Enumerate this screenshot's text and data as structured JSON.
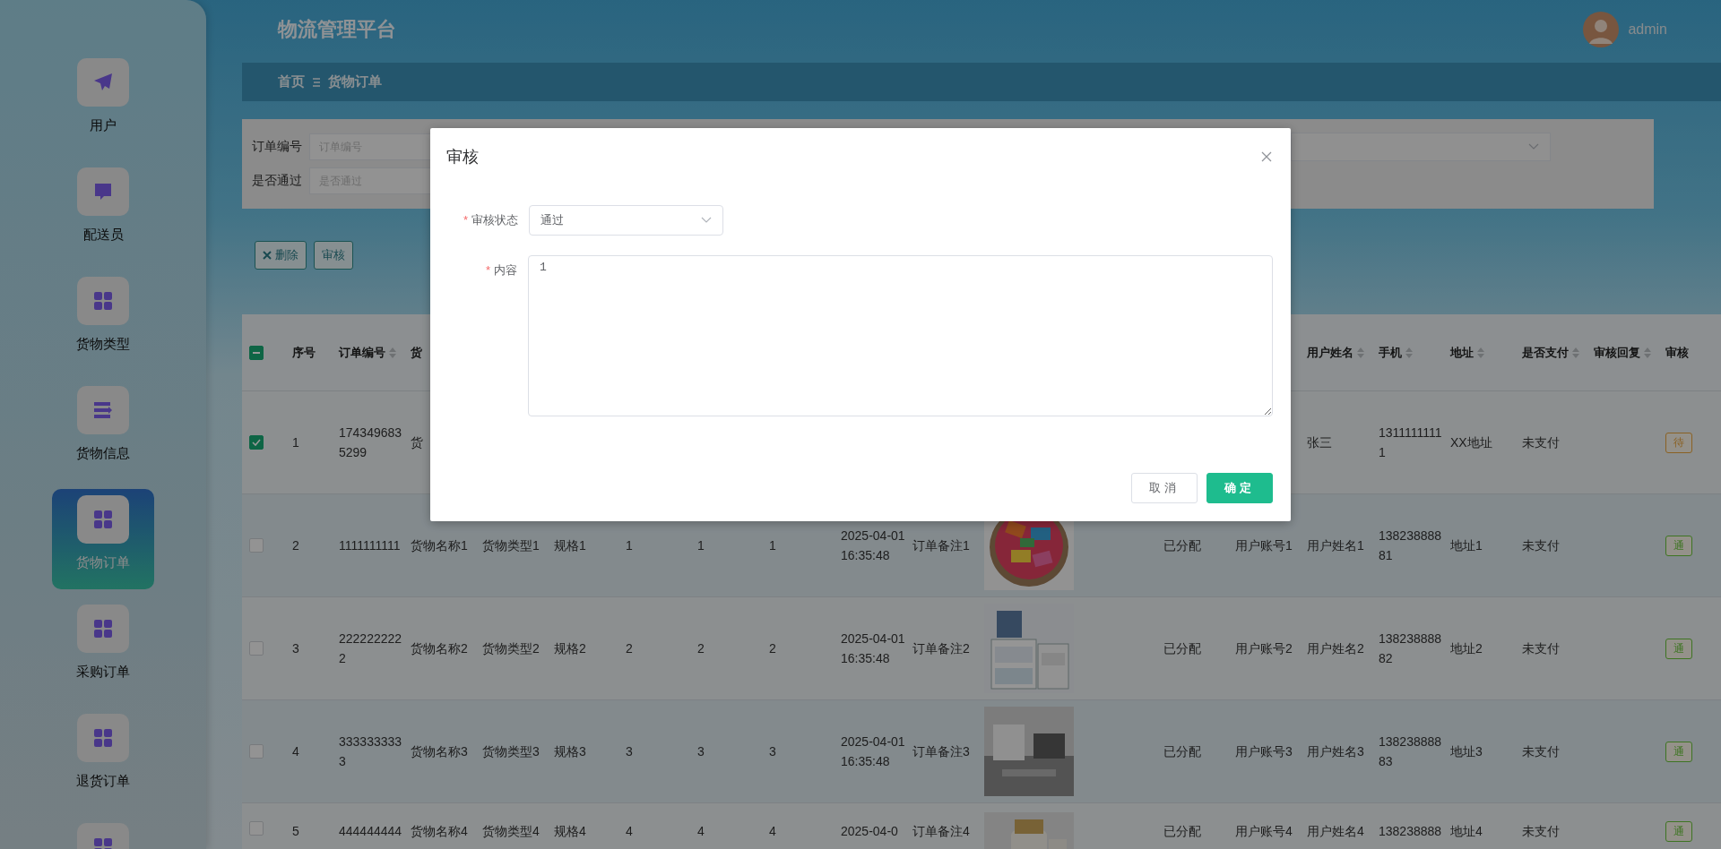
{
  "sidebar": {
    "items": [
      {
        "label": "用户",
        "selected": false
      },
      {
        "label": "配送员",
        "selected": false
      },
      {
        "label": "货物类型",
        "selected": false
      },
      {
        "label": "货物信息",
        "selected": false
      },
      {
        "label": "货物订单",
        "selected": true
      },
      {
        "label": "采购订单",
        "selected": false
      },
      {
        "label": "退货订单",
        "selected": false
      },
      {
        "selected": false
      }
    ]
  },
  "header": {
    "title": "物流管理平台",
    "user": "admin"
  },
  "breadcrumb": [
    "首页",
    "货物订单"
  ],
  "search": {
    "fields": [
      {
        "label": "订单编号",
        "placeholder": "订单编号"
      },
      {
        "label": "是否通过",
        "placeholder": "是否通过"
      }
    ]
  },
  "actions": [
    {
      "label": "删除"
    },
    {
      "label": "审核"
    }
  ],
  "table": {
    "header_checkbox": {
      "indeterminate": true
    },
    "columns": [
      {
        "label": "序号",
        "sortable": false
      },
      {
        "label": "订单编号",
        "sortable": true
      },
      {
        "label": "货",
        "sortable": false
      },
      null,
      null,
      null,
      null,
      null,
      null,
      null,
      null,
      null,
      null,
      null,
      {
        "label": "用户姓名",
        "sortable": true
      },
      {
        "label": "手机",
        "sortable": true
      },
      {
        "label": "地址",
        "sortable": true
      },
      {
        "label": "是否支付",
        "sortable": true
      },
      {
        "label": "审核回复",
        "sortable": true
      },
      {
        "label": "审核",
        "sortable": false
      }
    ],
    "rows": [
      {
        "kind": "full",
        "checked": true,
        "cells": [
          "1",
          "1743496835299",
          "货",
          null,
          null,
          null,
          null,
          null,
          null,
          null,
          null,
          null,
          null,
          null,
          "张三",
          "13111111111",
          "XX地址",
          "未支付",
          null
        ],
        "tag": {
          "text": "待",
          "kind": "pending"
        }
      },
      {
        "kind": "full",
        "checked": false,
        "cells": [
          "2",
          "1111111111",
          "货物名称1",
          "货物类型1",
          "规格1",
          "1",
          "1",
          "1",
          "2025-04-01 16:35:48",
          "订单备注1",
          {
            "kind": "picture"
          },
          null,
          "已分配",
          "用户账号1",
          "用户姓名1",
          "13823888881",
          "地址1",
          "未支付",
          null
        ],
        "tag": {
          "text": "通",
          "kind": "passed"
        }
      },
      {
        "kind": "full",
        "checked": false,
        "cells": [
          "3",
          "2222222222",
          "货物名称2",
          "货物类型2",
          "规格2",
          "2",
          "2",
          "2",
          "2025-04-01 16:35:48",
          "订单备注2",
          {
            "kind": "picture"
          },
          null,
          "已分配",
          "用户账号2",
          "用户姓名2",
          "13823888882",
          "地址2",
          "未支付",
          null
        ],
        "tag": {
          "text": "通",
          "kind": "passed"
        }
      },
      {
        "kind": "full",
        "checked": false,
        "cells": [
          "4",
          "3333333333",
          "货物名称3",
          "货物类型3",
          "规格3",
          "3",
          "3",
          "3",
          "2025-04-01 16:35:48",
          "订单备注3",
          {
            "kind": "picture"
          },
          null,
          "已分配",
          "用户账号3",
          "用户姓名3",
          "13823888883",
          "地址3",
          "未支付",
          null
        ],
        "tag": {
          "text": "通",
          "kind": "passed"
        }
      },
      {
        "kind": "partial",
        "checked": false,
        "cells": [
          "5",
          "444444444",
          "货物名称4",
          "货物类型4",
          "规格4",
          "4",
          "4",
          "4",
          "2025-04-0",
          "订单备注4",
          {
            "kind": "picture"
          },
          null,
          "已分配",
          "用户账号4",
          "用户姓名4",
          "138238888",
          "地址4",
          "未支付",
          null
        ],
        "tag": {
          "text": "通",
          "kind": "passed"
        }
      }
    ]
  },
  "dialog": {
    "title": "审核",
    "fields": [
      {
        "kind": "select",
        "mark": "*",
        "label": "审核状态",
        "value": "通过"
      },
      {
        "kind": "textarea",
        "mark": "*",
        "label": "内容",
        "value": "1"
      }
    ],
    "buttons": [
      {
        "label": "取消",
        "primary": false
      },
      {
        "label": "确定",
        "primary": true
      }
    ]
  }
}
